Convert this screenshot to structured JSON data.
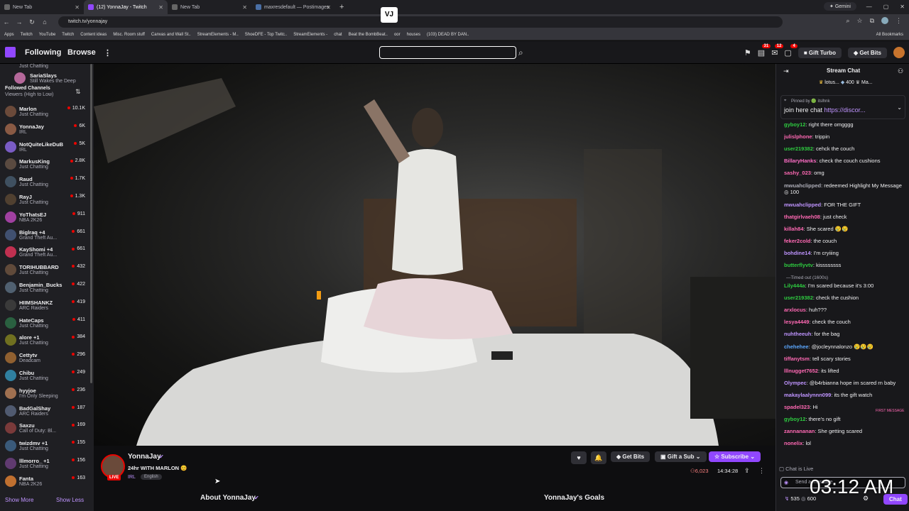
{
  "browser": {
    "tabs": [
      {
        "label": "New Tab"
      },
      {
        "label": "(12) YonnaJay - Twitch"
      },
      {
        "label": "New Tab"
      },
      {
        "label": "maxresdefault — Postimages"
      }
    ],
    "gemini": "Gemini",
    "url": "twitch.tv/yonnajay",
    "bookmarks": [
      "Apps",
      "Twitch",
      "YouTube",
      "Twitch",
      "Content ideas",
      "Misc. Room stuff",
      "Canvas and Wall St..",
      "StreamElements - M..",
      "ShoeDFE - Top Twitc..",
      "StreamElements -",
      "chat",
      "Beat the BombBeat..",
      "oor",
      "houses",
      "(103) DEAD BY DAN.."
    ],
    "all_bookmarks": "All Bookmarks"
  },
  "topnav": {
    "following": "Following",
    "browse": "Browse",
    "more": "⋮",
    "vlogo": "VJ",
    "search_placeholder": "",
    "badge1": "31",
    "badge2": "12",
    "badge3": "4",
    "gift_turbo": "Gift Turbo",
    "get_bits": "Get Bits"
  },
  "sidebar": {
    "top_name": "SariaSlays",
    "top_sub": "Still Wakes the Deep",
    "pre_status": "Just Chatting",
    "header": "Followed Channels",
    "sort": "Viewers (High to Low)",
    "channels": [
      {
        "name": "Marlon",
        "game": "Just Chatting",
        "viewers": "10.1K",
        "color": "#6b4a3a"
      },
      {
        "name": "YonnaJay",
        "game": "IRL",
        "viewers": "6K",
        "color": "#8a5a44"
      },
      {
        "name": "NotQuiteLikeDuB",
        "game": "IRL",
        "viewers": "5K",
        "color": "#7a5cc4"
      },
      {
        "name": "MarkusKing",
        "game": "Just Chatting",
        "viewers": "2.8K",
        "color": "#5a4a40"
      },
      {
        "name": "Raud",
        "game": "Just Chatting",
        "viewers": "1.7K",
        "color": "#3f5060"
      },
      {
        "name": "RayJ",
        "game": "Just Chatting",
        "viewers": "1.3K",
        "color": "#504030"
      },
      {
        "name": "YoThatsEJ",
        "game": "NBA 2K26",
        "viewers": "911",
        "color": "#a040a0"
      },
      {
        "name": "Biglraq +4",
        "game": "Grand Theft Au...",
        "viewers": "661",
        "color": "#405070"
      },
      {
        "name": "KayShomi +4",
        "game": "Grand Theft Au...",
        "viewers": "661",
        "color": "#c03050"
      },
      {
        "name": "TORIHUBBARD",
        "game": "Just Chatting",
        "viewers": "432",
        "color": "#604a3a"
      },
      {
        "name": "Benjamin_Bucks",
        "game": "Just Chatting",
        "viewers": "422",
        "color": "#506070"
      },
      {
        "name": "HIIMSHANKZ",
        "game": "ARC Raiders",
        "viewers": "419",
        "color": "#3a3a3a"
      },
      {
        "name": "HateCaps",
        "game": "Just Chatting",
        "viewers": "411",
        "color": "#2a6040"
      },
      {
        "name": "alore +1",
        "game": "Just Chatting",
        "viewers": "384",
        "color": "#707020"
      },
      {
        "name": "Cettytv",
        "game": "Deadcam",
        "viewers": "296",
        "color": "#906030"
      },
      {
        "name": "Chibu",
        "game": "Just Chatting",
        "viewers": "249",
        "color": "#3080a0"
      },
      {
        "name": "hyyjoe",
        "game": "I'm Only Sleeping",
        "viewers": "236",
        "color": "#a07050"
      },
      {
        "name": "BadGalShay",
        "game": "ARC Raiders",
        "viewers": "187",
        "color": "#505a70"
      },
      {
        "name": "Saxzu",
        "game": "Call of Duty: Bl...",
        "viewers": "169",
        "color": "#7a3a3a"
      },
      {
        "name": "twizdmv +1",
        "game": "Just Chatting",
        "viewers": "155",
        "color": "#3a5a7a"
      },
      {
        "name": "lllmorro_ +1",
        "game": "Just Chatting",
        "viewers": "156",
        "color": "#603a70"
      },
      {
        "name": "Fanta",
        "game": "NBA 2K26",
        "viewers": "163",
        "color": "#c07030"
      }
    ],
    "show_more": "Show More",
    "show_less": "Show Less"
  },
  "stream": {
    "streamer": "YonnaJay",
    "title": "24hr WITH MARLON 😊",
    "live": "LIVE",
    "tag1": "IRL",
    "tag2": "English",
    "viewers": "6,023",
    "uptime": "14:34:28",
    "get_bits": "Get Bits",
    "gift_sub": "Gift a Sub",
    "subscribe": "Subscribe",
    "about": "About YonnaJay",
    "goals": "YonnaJay's Goals"
  },
  "chat": {
    "title": "Stream Chat",
    "top_gift": "lotus...",
    "top_bits": "400",
    "top_gift2": "Ma...",
    "pinned_by": "Pinned by 🟢 itslhnk",
    "pinned_text": "join here chat ",
    "pinned_link": "https://discor...",
    "messages": [
      {
        "user": "gyboy12",
        "color": "#2ecc40",
        "text": "right there omgggg"
      },
      {
        "user": "julislphone",
        "color": "#ff69b4",
        "text": "trippin"
      },
      {
        "user": "user219382",
        "color": "#2ecc40",
        "text": "cehck the couch"
      },
      {
        "user": "BillaryHanks",
        "color": "#ff6ec7",
        "text": "check the couch cushions"
      },
      {
        "user": "sashy_023",
        "color": "#ff69b4",
        "text": "omg"
      },
      {
        "user": "mwuahclipped",
        "color": "#adadb8",
        "text": "redeemed Highlight My Message ◎ 100"
      },
      {
        "user": "mwuahclipped",
        "color": "#bf94ff",
        "text": "FOR THE GIFT"
      },
      {
        "user": "thatgirlvaeh08",
        "color": "#ff69b4",
        "text": "just check"
      },
      {
        "user": "killah84",
        "color": "#ff69b4",
        "text": "She scared 😢😢"
      },
      {
        "user": "feker2cold",
        "color": "#ff69b4",
        "text": "the couch"
      },
      {
        "user": "bohdine14",
        "color": "#bf94ff",
        "text": "I'm cryiiing"
      },
      {
        "user": "butterflyvtv",
        "color": "#2ecc40",
        "text": "kissssssss"
      },
      {
        "user": "Lily444a",
        "color": "#2ecc40",
        "text": "I'm scared because it's 3:00"
      },
      {
        "user": "user219382",
        "color": "#2ecc40",
        "text": "check the cushion"
      },
      {
        "user": "arxlocus",
        "color": "#ff69b4",
        "text": "huh???"
      },
      {
        "user": "lesya4449",
        "color": "#ff69b4",
        "text": "check the couch"
      },
      {
        "user": "nuhtheeuh",
        "color": "#bf94ff",
        "text": "for the bag"
      },
      {
        "user": "chehehee",
        "color": "#5da8ff",
        "text": "@jocleynnalonzo 😢😢😢"
      },
      {
        "user": "tiffanytsm",
        "color": "#ff69b4",
        "text": "tell scary stories"
      },
      {
        "user": "lllnugget7652",
        "color": "#ff69b4",
        "text": "its lifted"
      },
      {
        "user": "Olympec",
        "color": "#bf94ff",
        "text": "@b4rbianna hope im scared rn baby"
      },
      {
        "user": "makaylaalynnn099",
        "color": "#bf94ff",
        "text": "its the gift watch"
      },
      {
        "user": "spadel323",
        "color": "#ff69b4",
        "text": "Hi"
      },
      {
        "user": "gyboy12",
        "color": "#2ecc40",
        "text": "there's no gift"
      },
      {
        "user": "zannananan",
        "color": "#ff69b4",
        "text": "She getting scared"
      },
      {
        "user": "nonelix",
        "color": "#ff69b4",
        "text": "lol"
      }
    ],
    "timed_out": "—Timed out (1600s)",
    "first_message": "FIRST MESSAGE",
    "chat_live": "Chat is Live",
    "send_placeholder": "Send a message",
    "points": "535",
    "bits": "600",
    "chat_btn": "Chat"
  },
  "clock": "03:12 AM"
}
